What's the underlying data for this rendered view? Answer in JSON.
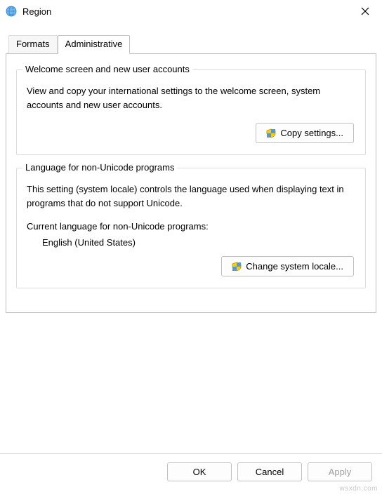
{
  "window": {
    "title": "Region"
  },
  "tabs": {
    "formats": "Formats",
    "administrative": "Administrative"
  },
  "group_welcome": {
    "title": "Welcome screen and new user accounts",
    "desc": "View and copy your international settings to the welcome screen, system accounts and new user accounts.",
    "copy_btn": "Copy settings..."
  },
  "group_locale": {
    "title": "Language for non-Unicode programs",
    "desc": "This setting (system locale) controls the language used when displaying text in programs that do not support Unicode.",
    "cur_label": "Current language for non-Unicode programs:",
    "cur_value": "English (United States)",
    "change_btn": "Change system locale..."
  },
  "buttons": {
    "ok": "OK",
    "cancel": "Cancel",
    "apply": "Apply"
  },
  "watermark": "wsxdn.com"
}
